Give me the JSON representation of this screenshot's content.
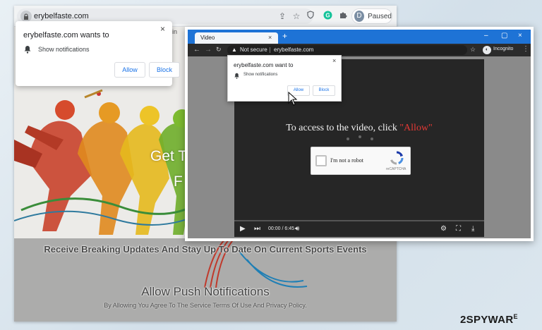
{
  "back_browser": {
    "url": "erybelfaste.com",
    "profile_label": "Paused",
    "profile_initial": "D",
    "icons": [
      "lock-icon",
      "share-icon",
      "star-icon",
      "shield-extension-icon",
      "grammarly-icon",
      "extensions-puzzle-icon"
    ],
    "page": {
      "login_text": "ogin",
      "get_text": "Get T",
      "f_text": "F",
      "breaking_text": "Receive Breaking Updates And Stay Up To Date On Current Sports Events",
      "push_title": "Allow Push Notifications",
      "push_subtitle": "By Allowing You Agree To The Service Terms Of Use And Privacy Policy."
    },
    "popup": {
      "title": "erybelfaste.com wants to",
      "text": "Show notifications",
      "allow": "Allow",
      "block": "Block",
      "close": "×"
    }
  },
  "front_browser": {
    "tab_title": "Video",
    "tab_close": "×",
    "new_tab": "+",
    "window_controls": [
      "–",
      "▢",
      "×"
    ],
    "security_label": "Not secure",
    "url": "erybelfaste.com",
    "incognito_label": "Incognito",
    "popup": {
      "title": "erybelfaste.com want to",
      "text": "Show notifications",
      "allow": "Allow",
      "block": "Block",
      "close": "×"
    },
    "video": {
      "headline_prefix": "To access to the video, click ",
      "headline_allow": "\"Allow\"",
      "captcha_label": "I'm not a robot",
      "captcha_brand": "reCAPTCHA",
      "time": "00:00 / 6:45",
      "progress": 0
    }
  },
  "watermark": {
    "main": "2SPYWAR",
    "sub": "E"
  },
  "colors": {
    "accent_blue": "#1a73e8",
    "chrome_blue": "#1e73d6",
    "allow_red": "#e53935"
  }
}
